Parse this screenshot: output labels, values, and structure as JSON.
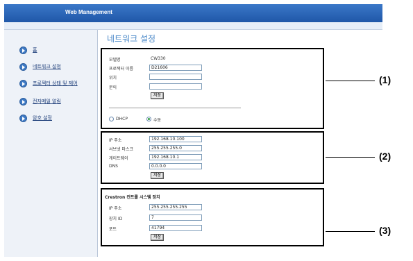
{
  "header": {
    "title": "Web Management"
  },
  "sidebar": {
    "items": [
      {
        "label": "홈"
      },
      {
        "label": "네트워크 설정"
      },
      {
        "label": "프로젝터 상태 및 제어"
      },
      {
        "label": "전자메일 알림"
      },
      {
        "label": "암호 설정"
      }
    ]
  },
  "page": {
    "title": "네트워크 설정"
  },
  "section1": {
    "model_label": "모델명",
    "model_value": "CW330",
    "name_label": "프로젝터 이름",
    "name_value": "D21606",
    "location_label": "위치",
    "location_value": "",
    "contact_label": "문의",
    "contact_value": "",
    "save_label": "저장",
    "dhcp_label": "DHCP",
    "dhcp_selected": false,
    "manual_label": "수동",
    "manual_selected": true
  },
  "section2": {
    "ip_label": "IP 주소",
    "ip_value": "192.168.10.100",
    "subnet_label": "서브넷 마스크",
    "subnet_value": "255.255.255.0",
    "gateway_label": "게이트웨이",
    "gateway_value": "192.168.10.1",
    "dns_label": "DNS",
    "dns_value": "0.0.0.0",
    "save_label": "저장"
  },
  "section3": {
    "heading": "Crestron 컨트롤 시스템 장치",
    "ip_label": "IP 주소",
    "ip_value": "255.255.255.255",
    "device_label": "장치 ID",
    "device_value": "7",
    "port_label": "포트",
    "port_value": "41794",
    "save_label": "저장"
  },
  "callouts": [
    "(1)",
    "(2)",
    "(3)"
  ]
}
